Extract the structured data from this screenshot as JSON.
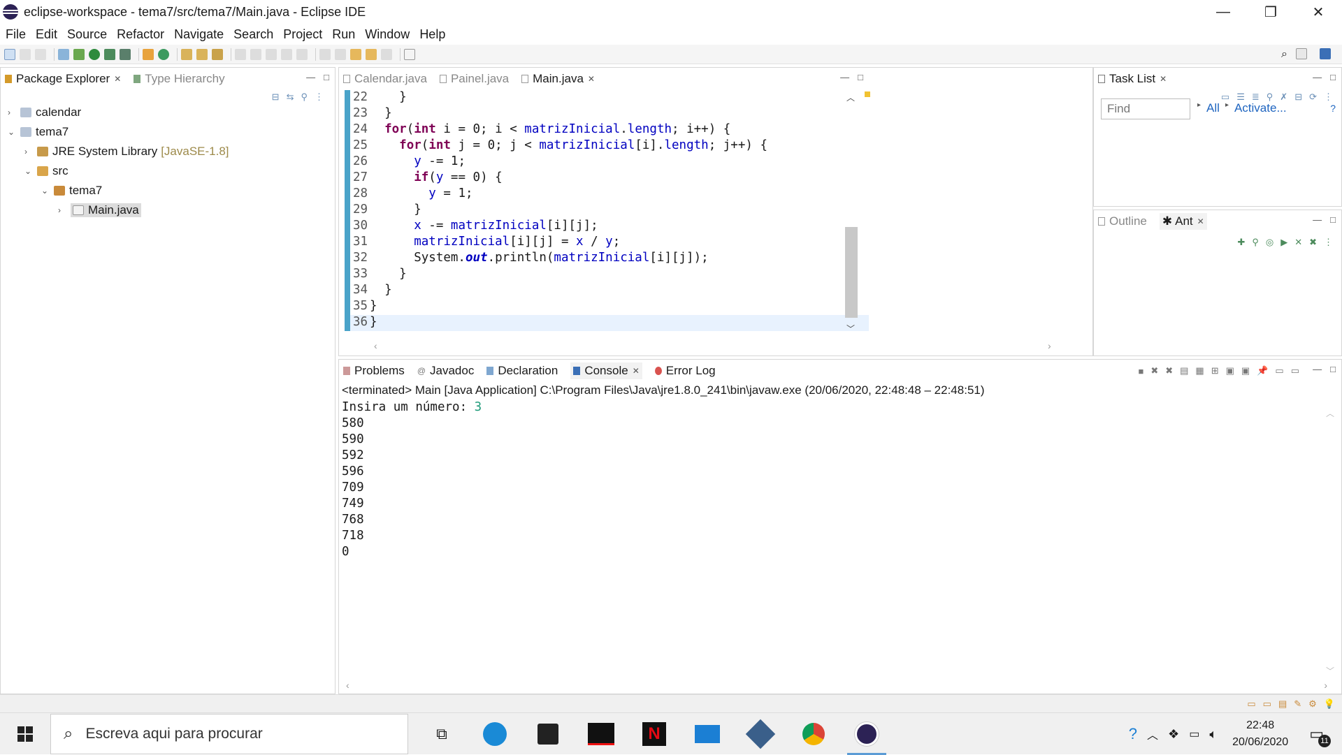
{
  "window": {
    "title": "eclipse-workspace - tema7/src/tema7/Main.java - Eclipse IDE",
    "minimize": "—",
    "maximize": "❐",
    "close": "✕"
  },
  "menu": [
    "File",
    "Edit",
    "Source",
    "Refactor",
    "Navigate",
    "Search",
    "Project",
    "Run",
    "Window",
    "Help"
  ],
  "package_explorer": {
    "tab_label": "Package Explorer",
    "tab2_label": "Type Hierarchy",
    "items": [
      {
        "label": "calendar",
        "indent": 0,
        "chev": "›",
        "icon": "project-icon"
      },
      {
        "label": "tema7",
        "indent": 0,
        "chev": "⌄",
        "icon": "project-icon"
      },
      {
        "label": "JRE System Library",
        "suffix": "[JavaSE-1.8]",
        "indent": 1,
        "chev": "›",
        "icon": "library-icon"
      },
      {
        "label": "src",
        "indent": 1,
        "chev": "⌄",
        "icon": "source-folder-icon"
      },
      {
        "label": "tema7",
        "indent": 2,
        "chev": "⌄",
        "icon": "package-icon"
      },
      {
        "label": "Main.java",
        "indent": 3,
        "chev": "›",
        "icon": "java-file-icon"
      }
    ]
  },
  "editor": {
    "tabs": [
      {
        "label": "Calendar.java",
        "active": false
      },
      {
        "label": "Painel.java",
        "active": false
      },
      {
        "label": "Main.java",
        "active": true
      }
    ],
    "lines": [
      {
        "n": "22",
        "html": "    }"
      },
      {
        "n": "23",
        "html": "  }"
      },
      {
        "n": "24",
        "html": "  <span class=\"kw\">for</span>(<span class=\"kw\">int</span> i = 0; i &lt; <span class=\"fld\">matrizInicial</span>.<span class=\"fld\">length</span>; i++) {"
      },
      {
        "n": "25",
        "html": "    <span class=\"kw\">for</span>(<span class=\"kw\">int</span> j = 0; j &lt; <span class=\"fld\">matrizInicial</span>[i].<span class=\"fld\">length</span>; j++) {"
      },
      {
        "n": "26",
        "html": "      <span class=\"fld\">y</span> -= 1;"
      },
      {
        "n": "27",
        "html": "      <span class=\"kw\">if</span>(<span class=\"fld\">y</span> == 0) {"
      },
      {
        "n": "28",
        "html": "        <span class=\"fld\">y</span> = 1;"
      },
      {
        "n": "29",
        "html": "      }"
      },
      {
        "n": "30",
        "html": "      <span class=\"fld\">x</span> -= <span class=\"fld\">matrizInicial</span>[i][j];"
      },
      {
        "n": "31",
        "html": "      <span class=\"fld\">matrizInicial</span>[i][j] = <span class=\"fld\">x</span> / <span class=\"fld\">y</span>;"
      },
      {
        "n": "32",
        "html": "      System.<span class=\"sfld\">out</span>.println(<span class=\"fld\">matrizInicial</span>[i][j]);"
      },
      {
        "n": "33",
        "html": "    }"
      },
      {
        "n": "34",
        "html": "  }"
      },
      {
        "n": "35",
        "html": "}"
      },
      {
        "n": "36",
        "html": "}"
      }
    ]
  },
  "task_list": {
    "tab_label": "Task List",
    "find_placeholder": "Find",
    "all_label": "All",
    "activate_label": "Activate..."
  },
  "outline": {
    "tab_label": "Outline",
    "ant_label": "Ant"
  },
  "bottom_panel": {
    "tabs": [
      {
        "label": "Problems",
        "active": false
      },
      {
        "label": "Javadoc",
        "active": false
      },
      {
        "label": "Declaration",
        "active": false
      },
      {
        "label": "Console",
        "active": true
      },
      {
        "label": "Error Log",
        "active": false
      }
    ],
    "terminated": "<terminated> Main [Java Application] C:\\Program Files\\Java\\jre1.8.0_241\\bin\\javaw.exe  (20/06/2020, 22:48:48 – 22:48:51)",
    "prompt": "Insira um número: ",
    "input": "3",
    "output": [
      "580",
      "590",
      "592",
      "596",
      "709",
      "749",
      "768",
      "718",
      "0"
    ]
  },
  "taskbar": {
    "search_placeholder": "Escreva aqui para procurar",
    "time": "22:48",
    "date": "20/06/2020",
    "notifications": "11"
  }
}
